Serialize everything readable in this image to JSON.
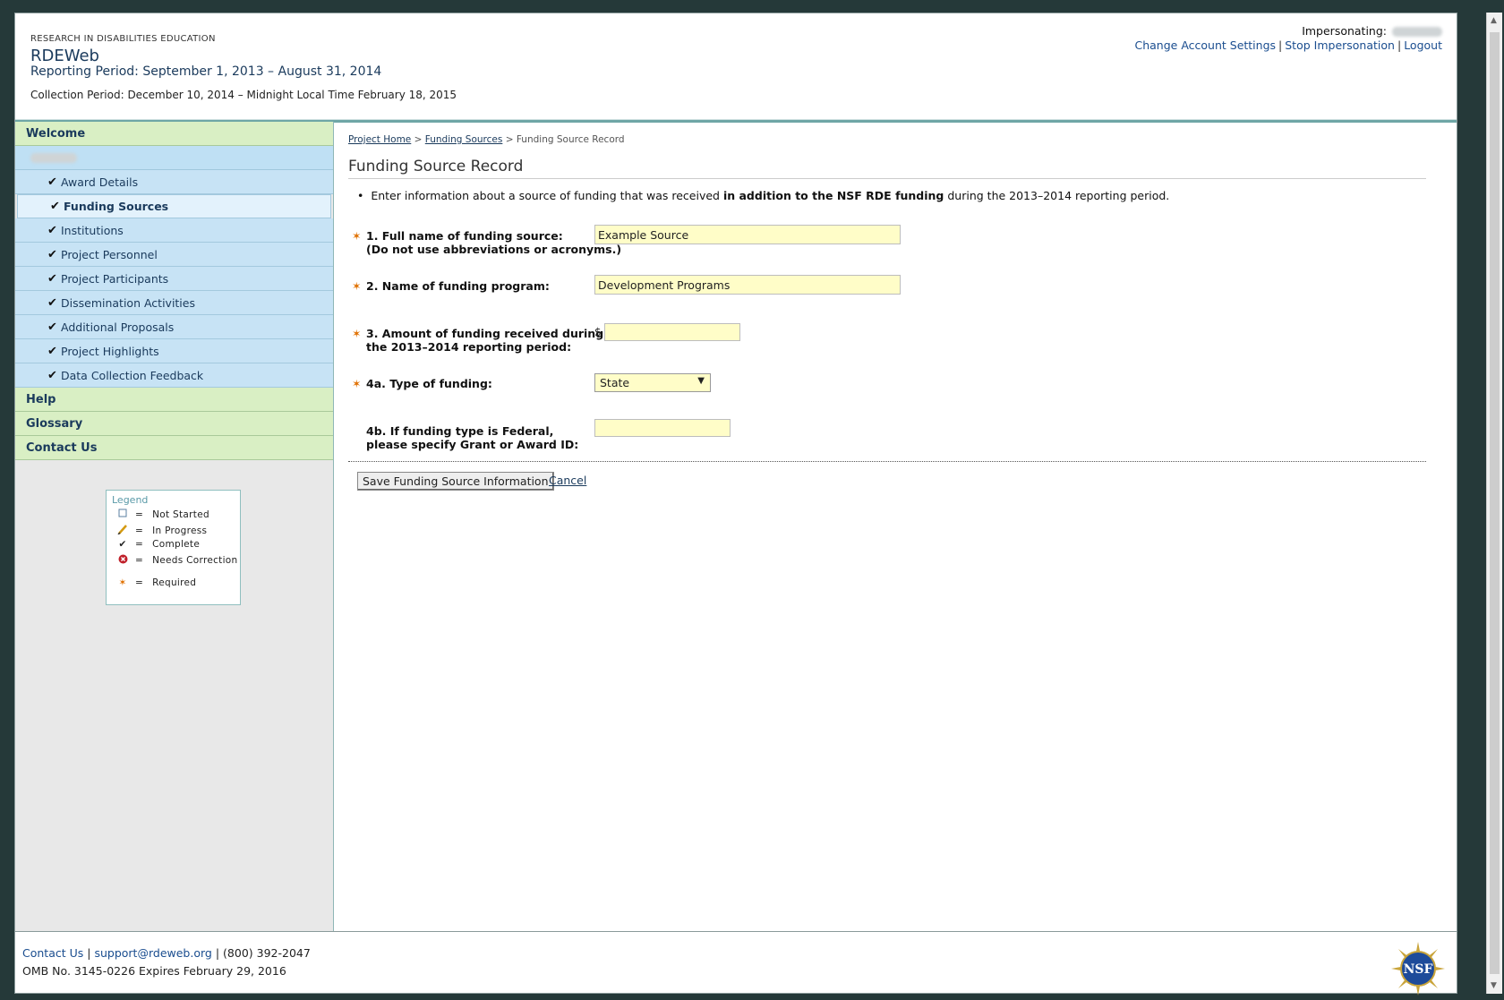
{
  "header": {
    "org": "RESEARCH IN DISABILITIES EDUCATION",
    "app_title": "RDEWeb",
    "reporting_period": "Reporting Period: September 1, 2013 – August 31, 2014",
    "collection_period": "Collection Period: December 10, 2014 – Midnight Local Time February 18, 2015",
    "impersonating_label": "Impersonating:",
    "links": {
      "change_settings": "Change Account Settings",
      "stop_impersonation": "Stop Impersonation",
      "logout": "Logout",
      "separator": "|"
    }
  },
  "sidebar": {
    "welcome": "Welcome",
    "items": [
      {
        "label": "Award Details",
        "status": "complete"
      },
      {
        "label": "Funding Sources",
        "status": "complete"
      },
      {
        "label": "Institutions",
        "status": "complete"
      },
      {
        "label": "Project Personnel",
        "status": "complete"
      },
      {
        "label": "Project Participants",
        "status": "complete"
      },
      {
        "label": "Dissemination Activities",
        "status": "complete"
      },
      {
        "label": "Additional Proposals",
        "status": "complete"
      },
      {
        "label": "Project Highlights",
        "status": "complete"
      },
      {
        "label": "Data Collection Feedback",
        "status": "complete"
      }
    ],
    "help": "Help",
    "glossary": "Glossary",
    "contact": "Contact Us",
    "check_glyph": "✔",
    "legend": {
      "title": "Legend",
      "eq": "=",
      "not_started": "Not Started",
      "in_progress": "In Progress",
      "complete": "Complete",
      "needs_correction": "Needs Correction",
      "required": "Required"
    }
  },
  "main": {
    "breadcrumb": {
      "home": "Project Home",
      "funding": "Funding Sources",
      "current": "Funding Source Record",
      "sep": ">"
    },
    "title": "Funding Source Record",
    "intro_pre": "Enter information about a source of funding that was received ",
    "intro_bold": "in addition to the NSF RDE funding",
    "intro_post": " during the 2013–2014 reporting period.",
    "required_glyph": "✶",
    "fields": {
      "f1_line1": "1. Full name of funding source:",
      "f1_line2": "(Do not use abbreviations or acronyms.)",
      "f1_value": "Example Source",
      "f2_label": "2. Name of funding program:",
      "f2_value": "Development Programs",
      "f3_line1": "3. Amount of funding received during",
      "f3_line2": "the 2013–2014 reporting period:",
      "f3_currency": "$",
      "f3_value": "",
      "f4a_label": "4a. Type of funding:",
      "f4a_value": "State",
      "f4b_line1": "4b. If funding type is Federal,",
      "f4b_line2": "please specify Grant or Award ID:",
      "f4b_value": ""
    },
    "save_button": "Save Funding Source Information",
    "cancel": "Cancel"
  },
  "footer": {
    "contact": "Contact Us",
    "email": "support@rdeweb.org",
    "phone": "(800) 392-2047",
    "sep": "|",
    "omb": "OMB No. 3145-0226 Expires February 29, 2016",
    "logo_text": "NSF"
  },
  "colors": {
    "frame": "#253939",
    "nav_green": "#d9efc4",
    "nav_blue": "#c7e3f5",
    "input_yellow": "#fffdc8",
    "required_orange": "#e07000",
    "link_blue": "#1a4d8f"
  }
}
